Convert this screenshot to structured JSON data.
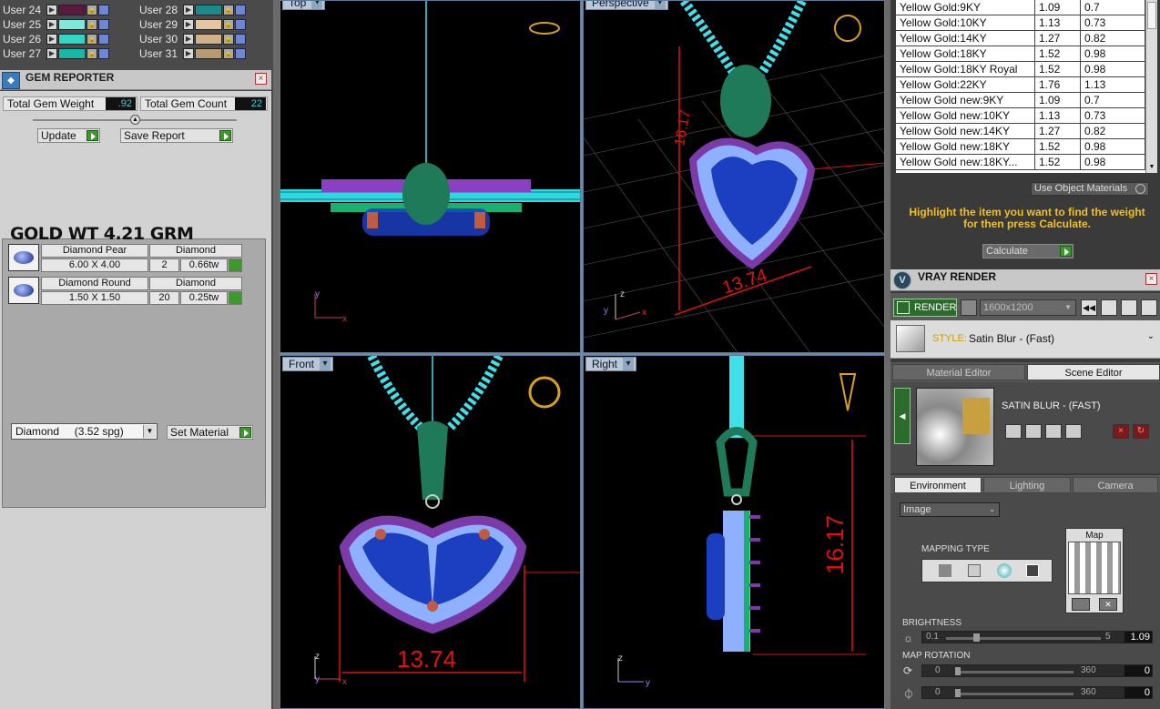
{
  "users_left": [
    {
      "label": "User 24",
      "color": "#5a1a40"
    },
    {
      "label": "User 25",
      "color": "#7fe8dc"
    },
    {
      "label": "User 26",
      "color": "#2fd6c4"
    },
    {
      "label": "User 27",
      "color": "#16b8a8"
    }
  ],
  "users_right": [
    {
      "label": "User 28",
      "color": "#1a8a8a"
    },
    {
      "label": "User 29",
      "color": "#e6c6a0"
    },
    {
      "label": "User 30",
      "color": "#d2b08a"
    },
    {
      "label": "User 31",
      "color": "#b89a72"
    }
  ],
  "gem_reporter": {
    "title": "GEM REPORTER",
    "total_weight_label": "Total Gem Weight",
    "total_weight_value": ".92",
    "total_count_label": "Total Gem Count",
    "total_count_value": "22",
    "update_label": "Update",
    "save_label": "Save Report",
    "gems": [
      {
        "name": "Diamond Pear",
        "material": "Diamond",
        "size": "6.00 X 4.00",
        "count": "2",
        "weight": "0.66tw"
      },
      {
        "name": "Diamond Round",
        "material": "Diamond",
        "size": "1.50 X 1.50",
        "count": "20",
        "weight": "0.25tw"
      }
    ],
    "gold_weight": "GOLD WT 4.21 GRM",
    "material_select": "Diamond     (3.52 spg)",
    "set_material_label": "Set Material"
  },
  "viewports": {
    "top": {
      "label": "Top"
    },
    "perspective": {
      "label": "Perspective",
      "dim": "13.74",
      "dim2": "16.17"
    },
    "front": {
      "label": "Front",
      "dim": "13.74"
    },
    "right": {
      "label": "Right",
      "dim": "16.17"
    }
  },
  "materials": [
    [
      "Yellow Gold:9KY",
      "1.09",
      "0.7"
    ],
    [
      "Yellow Gold:10KY",
      "1.13",
      "0.73"
    ],
    [
      "Yellow Gold:14KY",
      "1.27",
      "0.82"
    ],
    [
      "Yellow Gold:18KY",
      "1.52",
      "0.98"
    ],
    [
      "Yellow Gold:18KY Royal",
      "1.52",
      "0.98"
    ],
    [
      "Yellow Gold:22KY",
      "1.76",
      "1.13"
    ],
    [
      "Yellow Gold new:9KY",
      "1.09",
      "0.7"
    ],
    [
      "Yellow Gold new:10KY",
      "1.13",
      "0.73"
    ],
    [
      "Yellow Gold new:14KY",
      "1.27",
      "0.82"
    ],
    [
      "Yellow Gold new:18KY",
      "1.52",
      "0.98"
    ],
    [
      "Yellow Gold new:18KY...",
      "1.52",
      "0.98"
    ]
  ],
  "weight_calc": {
    "use_object_materials": "Use Object Materials",
    "hint": "Highlight the item you want to find the weight for then press Calculate.",
    "calculate_label": "Calculate"
  },
  "vray": {
    "title": "VRAY RENDER",
    "render_label": "RENDER",
    "resolution": "1600x1200",
    "style_prefix": "STYLE:",
    "style_value": "Satin Blur - (Fast)",
    "tab_material": "Material Editor",
    "tab_scene": "Scene Editor",
    "scene_name": "SATIN BLUR - (FAST)",
    "tab_environment": "Environment",
    "tab_lighting": "Lighting",
    "tab_camera": "Camera",
    "env_type": "Image",
    "mapping_type": "MAPPING TYPE",
    "map_label": "Map",
    "brightness_label": "BRIGHTNESS",
    "brightness_min": "0.1",
    "brightness_max": "5",
    "brightness_value": "1.09",
    "rotation_label": "MAP ROTATION",
    "rot1_min": "0",
    "rot1_max": "360",
    "rot1_value": "0",
    "rot2_min": "0",
    "rot2_max": "360",
    "rot2_value": "0"
  },
  "colors": {
    "accent_yellow": "#f0c020",
    "go_green": "#3a9a2a",
    "chain": "#3fe0e8",
    "gem_blue": "#1b3fc0",
    "dim_red": "#e01010"
  }
}
